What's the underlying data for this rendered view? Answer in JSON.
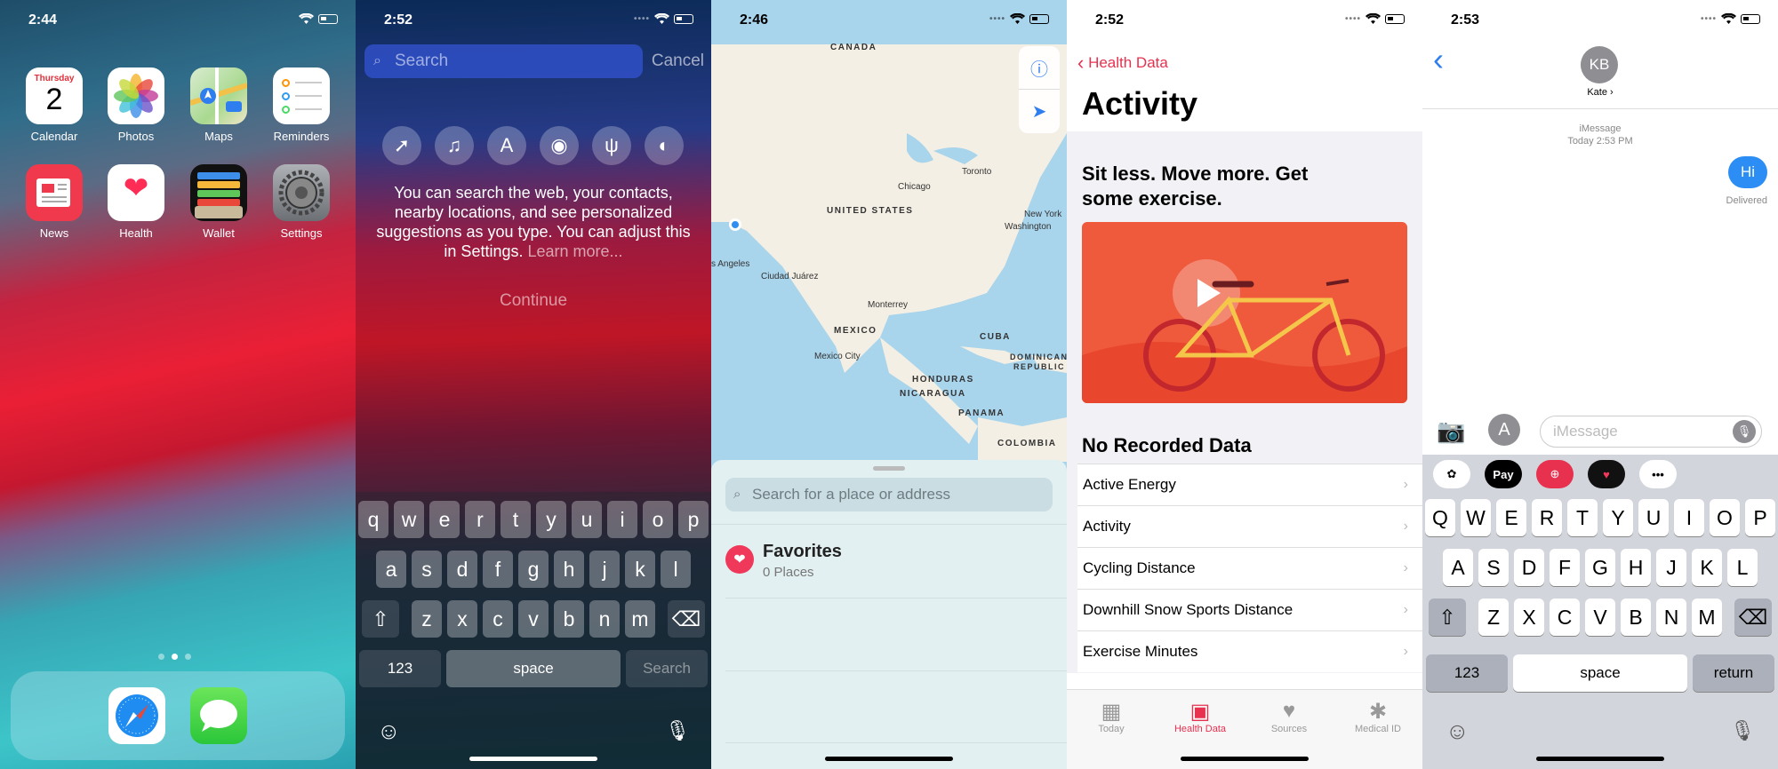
{
  "panel1": {
    "time": "2:44",
    "cal_day": "Thursday",
    "cal_date": "2",
    "apps": [
      "Calendar",
      "Photos",
      "Maps",
      "Reminders",
      "News",
      "Health",
      "Wallet",
      "Settings"
    ]
  },
  "panel2": {
    "time": "2:52",
    "search_placeholder": "Search",
    "cancel": "Cancel",
    "info": "You can search the web, your contacts, nearby locations, and see personalized suggestions as you type. You can adjust this in Settings.",
    "learn_more": "Learn more...",
    "continue": "Continue",
    "row1": [
      "q",
      "w",
      "e",
      "r",
      "t",
      "y",
      "u",
      "i",
      "o",
      "p"
    ],
    "row2": [
      "a",
      "s",
      "d",
      "f",
      "g",
      "h",
      "j",
      "k",
      "l"
    ],
    "row3": [
      "z",
      "x",
      "c",
      "v",
      "b",
      "n",
      "m"
    ],
    "k123": "123",
    "space": "space",
    "search_key": "Search"
  },
  "panel3": {
    "time": "2:46",
    "labels": {
      "canada": "CANADA",
      "us": "UNITED STATES",
      "mexico": "MEXICO",
      "cuba": "CUBA",
      "honduras": "HONDURAS",
      "nicaragua": "NICARAGUA",
      "panama": "PANAMA",
      "colombia": "COLOMBIA",
      "dominican": "DOMINICAN",
      "republic": "REPUBLIC"
    },
    "cities": {
      "toronto": "Toronto",
      "chicago": "Chicago",
      "newyork": "New York",
      "washington": "Washington",
      "losangeles": "s Angeles",
      "juarez": "Ciudad Juárez",
      "monterrey": "Monterrey",
      "mexicocity": "Mexico City"
    },
    "search_placeholder": "Search for a place or address",
    "favorites": "Favorites",
    "places": "0 Places"
  },
  "panel4": {
    "time": "2:52",
    "back": "Health Data",
    "title": "Activity",
    "subtitle": "Sit less. Move more. Get some exercise.",
    "no_data": "No Recorded Data",
    "rows": [
      "Active Energy",
      "Activity",
      "Cycling Distance",
      "Downhill Snow Sports Distance",
      "Exercise Minutes"
    ],
    "tabs": [
      "Today",
      "Health Data",
      "Sources",
      "Medical ID"
    ]
  },
  "panel5": {
    "time": "2:53",
    "initials": "KB",
    "name": "Kate",
    "service": "iMessage",
    "timestamp": "Today 2:53 PM",
    "message": "Hi",
    "delivered": "Delivered",
    "placeholder": "iMessage",
    "row1": [
      "Q",
      "W",
      "E",
      "R",
      "T",
      "Y",
      "U",
      "I",
      "O",
      "P"
    ],
    "row2": [
      "A",
      "S",
      "D",
      "F",
      "G",
      "H",
      "J",
      "K",
      "L"
    ],
    "row3": [
      "Z",
      "X",
      "C",
      "V",
      "B",
      "N",
      "M"
    ],
    "k123": "123",
    "space": "space",
    "return": "return",
    "applepay": "Pay"
  }
}
